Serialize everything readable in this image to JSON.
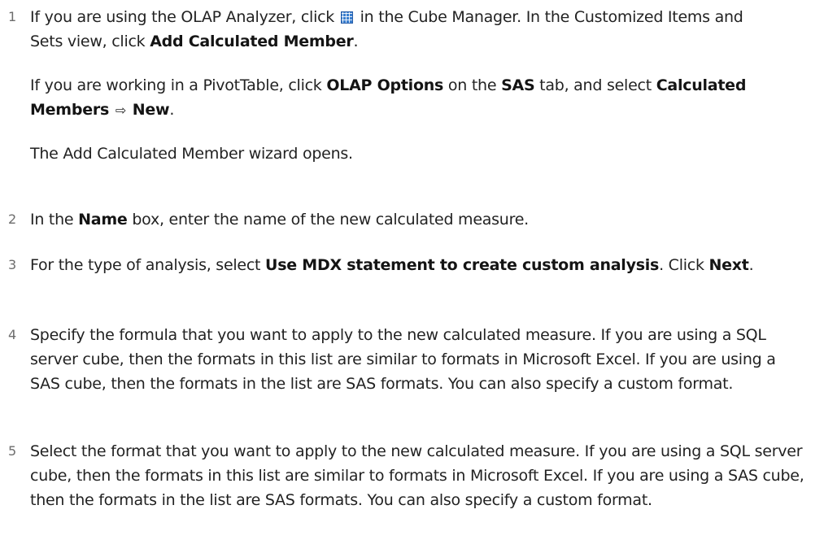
{
  "steps": [
    {
      "number": "1",
      "p1": {
        "t1": "If you are using the OLAP Analyzer, click ",
        "icon": "cube-manager-grid-icon",
        "t2": " in the Cube Manager. In the Customized Items and Sets view, click ",
        "b1": "Add Calculated Member",
        "t3": "."
      },
      "p2": {
        "t1": "If you are working in a PivotTable, click ",
        "b1": "OLAP Options",
        "t2": " on the ",
        "b2": "SAS",
        "t3": " tab, and select ",
        "b3": "Calculated Members",
        "arrow": "⇨",
        "b4": "New",
        "t4": "."
      },
      "p3": {
        "t1": "The Add Calculated Member wizard opens."
      }
    },
    {
      "number": "2",
      "p1": {
        "t1": "In the ",
        "b1": "Name",
        "t2": " box, enter the name of the new calculated measure."
      }
    },
    {
      "number": "3",
      "p1": {
        "t1": "For the type of analysis, select ",
        "b1": "Use MDX statement to create custom analysis",
        "t2": ". Click ",
        "b2": "Next",
        "t3": "."
      }
    },
    {
      "number": "4",
      "p1": {
        "t1": "Specify the formula that you want to apply to the new calculated measure. If you are using a SQL server cube, then the formats in this list are similar to formats in Microsoft Excel. If you are using a SAS cube, then the formats in the list are SAS formats. You can also specify a custom format."
      }
    },
    {
      "number": "5",
      "p1": {
        "t1": "Select the format that you want to apply to the new calculated measure. If you are using a SQL server cube, then the formats in this list are similar to formats in Microsoft Excel. If you are using a SAS cube, then the formats in the list are SAS formats. You can also specify a custom format."
      }
    }
  ]
}
